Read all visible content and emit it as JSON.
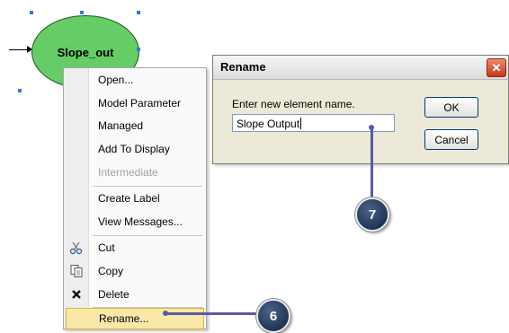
{
  "model": {
    "node_label": "Slope_out"
  },
  "context_menu": {
    "items": [
      {
        "label": "Open...",
        "icon": "",
        "disabled": false
      },
      {
        "label": "Model Parameter",
        "icon": "",
        "disabled": false
      },
      {
        "label": "Managed",
        "icon": "",
        "disabled": false
      },
      {
        "label": "Add To Display",
        "icon": "",
        "disabled": false
      },
      {
        "label": "Intermediate",
        "icon": "",
        "disabled": true
      },
      {
        "label": "Create Label",
        "icon": "",
        "disabled": false
      },
      {
        "label": "View Messages...",
        "icon": "",
        "disabled": false
      },
      {
        "label": "Cut",
        "icon": "scissors-icon",
        "disabled": false
      },
      {
        "label": "Copy",
        "icon": "copy-icon",
        "disabled": false
      },
      {
        "label": "Delete",
        "icon": "delete-x-icon",
        "disabled": false
      },
      {
        "label": "Rename...",
        "icon": "",
        "disabled": false,
        "highlighted": true
      }
    ]
  },
  "dialog": {
    "title": "Rename",
    "prompt": "Enter new element name.",
    "input_value": "Slope Output",
    "ok_label": "OK",
    "cancel_label": "Cancel",
    "close_glyph": "✕"
  },
  "callouts": {
    "step_rename": "6",
    "step_input": "7"
  },
  "colors": {
    "node_fill": "#66cc66",
    "highlight": "#f9e8a8",
    "callout_line": "#5a5aa8",
    "badge": "#2b4268"
  }
}
